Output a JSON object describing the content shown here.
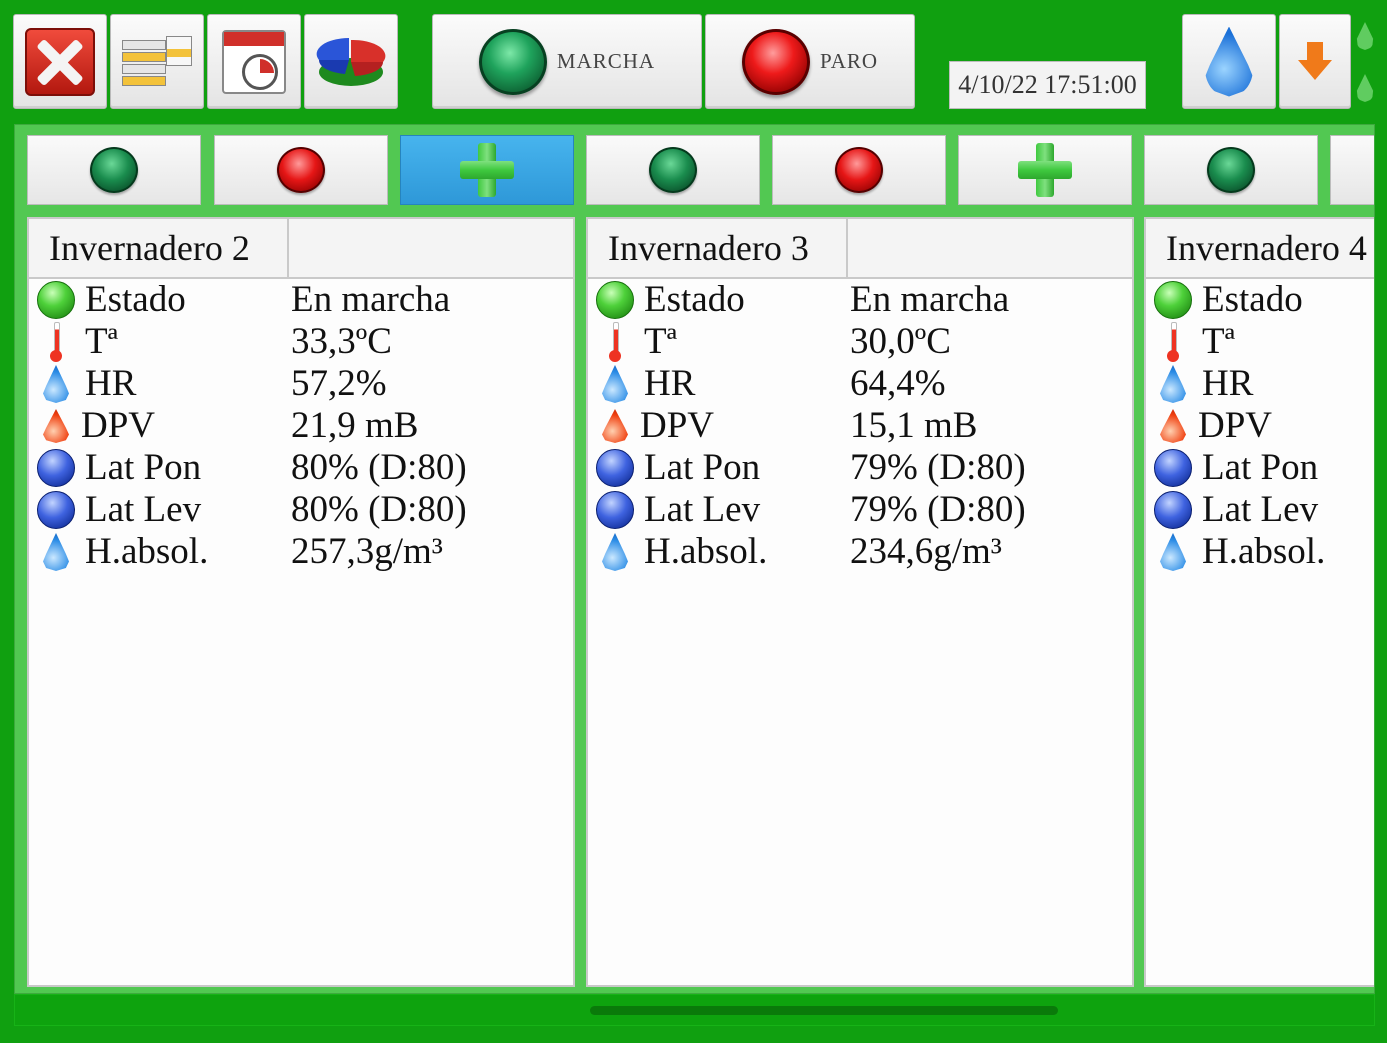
{
  "toolbar": {
    "close_icon": "close-icon",
    "list_icon": "list-icon",
    "calendar_icon": "calendar-clock-icon",
    "chart_icon": "pie-chart-icon",
    "marcha_label": "MARCHA",
    "paro_label": "PARO",
    "datetime": "4/10/22 17:51:00",
    "water_icon": "water-drop-icon",
    "download_icon": "arrow-down-icon"
  },
  "controls": [
    {
      "type": "start",
      "icon": "green-button-icon"
    },
    {
      "type": "stop",
      "icon": "red-button-icon"
    },
    {
      "type": "add",
      "icon": "plus-icon",
      "active": true
    },
    {
      "type": "start",
      "icon": "green-button-icon"
    },
    {
      "type": "stop",
      "icon": "red-button-icon"
    },
    {
      "type": "add",
      "icon": "plus-icon"
    },
    {
      "type": "start",
      "icon": "green-button-icon"
    }
  ],
  "greenhouses": [
    {
      "name": "Invernadero 2",
      "rows": [
        {
          "label": "Estado",
          "value": "En marcha",
          "icon": "status-green-icon"
        },
        {
          "label": "Tª",
          "value": "33,3ºC",
          "icon": "thermometer-icon"
        },
        {
          "label": "HR",
          "value": "57,2%",
          "icon": "humidity-drop-icon"
        },
        {
          "label": "DPV",
          "value": "21,9 mB",
          "icon": "red-drop-icon"
        },
        {
          "label": "Lat Pon",
          "value": "80% (D:80)",
          "icon": "blue-ball-icon"
        },
        {
          "label": "Lat Lev",
          "value": "80% (D:80)",
          "icon": "blue-ball-icon"
        },
        {
          "label": "H.absol.",
          "value": "257,3g/m³",
          "icon": "humidity-drop-icon"
        }
      ]
    },
    {
      "name": "Invernadero 3",
      "rows": [
        {
          "label": "Estado",
          "value": "En marcha",
          "icon": "status-green-icon"
        },
        {
          "label": "Tª",
          "value": "30,0ºC",
          "icon": "thermometer-icon"
        },
        {
          "label": "HR",
          "value": "64,4%",
          "icon": "humidity-drop-icon"
        },
        {
          "label": "DPV",
          "value": "15,1 mB",
          "icon": "red-drop-icon"
        },
        {
          "label": "Lat Pon",
          "value": "79% (D:80)",
          "icon": "blue-ball-icon"
        },
        {
          "label": "Lat Lev",
          "value": "79% (D:80)",
          "icon": "blue-ball-icon"
        },
        {
          "label": "H.absol.",
          "value": "234,6g/m³",
          "icon": "humidity-drop-icon"
        }
      ]
    },
    {
      "name": "Invernadero 4",
      "rows": [
        {
          "label": "Estado",
          "value": "",
          "icon": "status-green-icon"
        },
        {
          "label": "Tª",
          "value": "",
          "icon": "thermometer-icon"
        },
        {
          "label": "HR",
          "value": "",
          "icon": "humidity-drop-icon"
        },
        {
          "label": "DPV",
          "value": "",
          "icon": "red-drop-icon"
        },
        {
          "label": "Lat Pon",
          "value": "",
          "icon": "blue-ball-icon"
        },
        {
          "label": "Lat Lev",
          "value": "",
          "icon": "blue-ball-icon"
        },
        {
          "label": "H.absol.",
          "value": "",
          "icon": "humidity-drop-icon"
        }
      ]
    }
  ],
  "colors": {
    "background": "#10a010",
    "panel": "#52c852",
    "active_control": "#3aa8e6"
  }
}
